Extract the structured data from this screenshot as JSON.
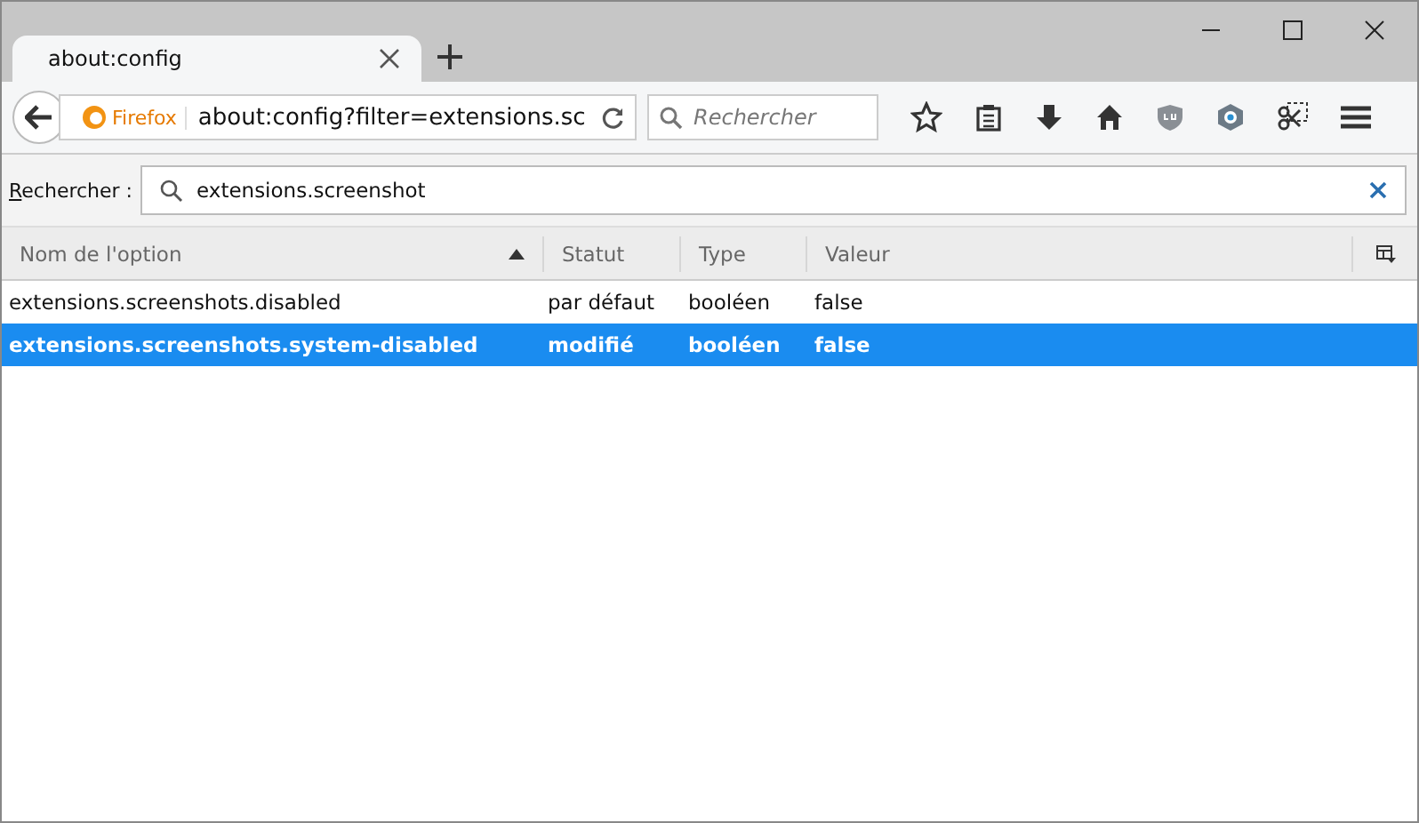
{
  "tab": {
    "title": "about:config",
    "selected": true
  },
  "nav": {
    "identity": "Firefox",
    "url": "about:config?filter=extensions.sc",
    "search_placeholder": "Rechercher"
  },
  "filter": {
    "label": "Rechercher :",
    "value": "extensions.screenshot"
  },
  "table": {
    "columns": [
      "Nom de l'option",
      "Statut",
      "Type",
      "Valeur"
    ],
    "rows": [
      {
        "cells": [
          "extensions.screenshots.disabled",
          "par défaut",
          "booléen",
          "false"
        ],
        "modified": false,
        "selected": false
      },
      {
        "cells": [
          "extensions.screenshots.system-disabled",
          "modifié",
          "booléen",
          "false"
        ],
        "modified": true,
        "selected": true
      }
    ]
  }
}
